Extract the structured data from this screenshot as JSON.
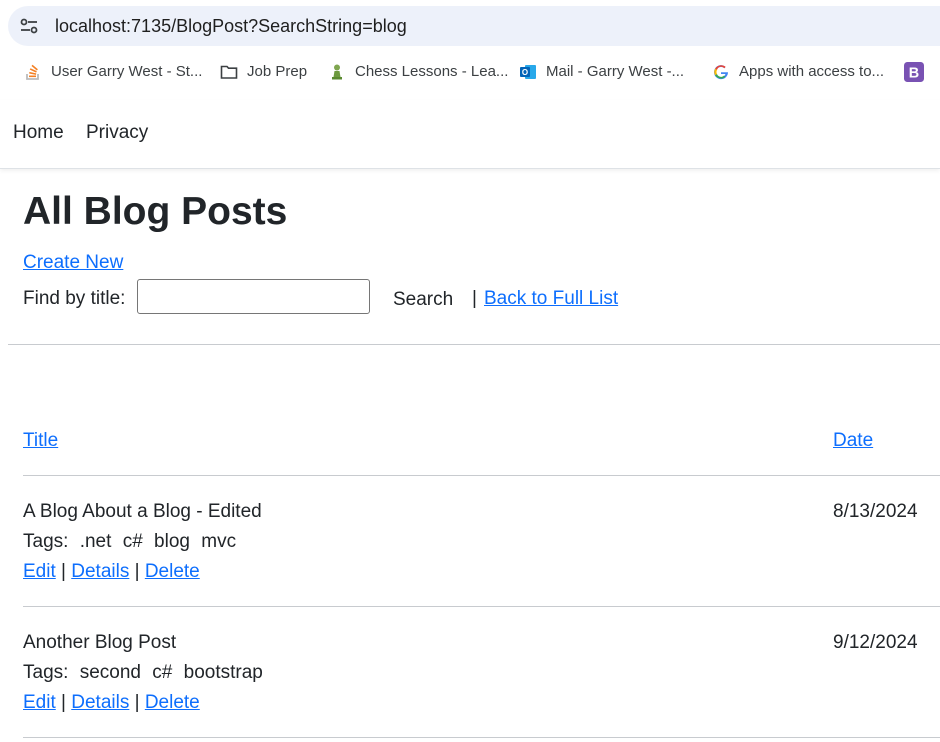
{
  "browser": {
    "url": "localhost:7135/BlogPost?SearchString=blog",
    "bookmarks": [
      {
        "icon": "stackoverflow-icon",
        "label": "User Garry West - St..."
      },
      {
        "icon": "folder-icon",
        "label": "Job Prep"
      },
      {
        "icon": "chess-pawn-icon",
        "label": "Chess Lessons - Lea..."
      },
      {
        "icon": "outlook-icon",
        "label": "Mail - Garry West -..."
      },
      {
        "icon": "google-icon",
        "label": "Apps with access to..."
      },
      {
        "icon": "bootstrap-icon",
        "label": "B"
      }
    ],
    "colors": {
      "address_bar": "#edf1fa",
      "link": "#0d6efd"
    }
  },
  "nav": {
    "home": "Home",
    "privacy": "Privacy"
  },
  "page": {
    "title": "All Blog Posts",
    "create_new": "Create New",
    "find_label": "Find by title:",
    "search_value": "",
    "search_button": "Search",
    "pipe": "|",
    "back_link": "Back to Full List"
  },
  "table": {
    "headers": {
      "title": "Title",
      "date": "Date"
    },
    "rows": [
      {
        "title": "A Blog About a Blog - Edited",
        "tags_label": "Tags:",
        "tags": [
          ".net",
          "c#",
          "blog",
          "mvc"
        ],
        "date": "8/13/2024",
        "actions": {
          "edit": "Edit",
          "details": "Details",
          "delete": "Delete",
          "sep": "|"
        }
      },
      {
        "title": "Another Blog Post",
        "tags_label": "Tags:",
        "tags": [
          "second",
          "c#",
          "bootstrap"
        ],
        "date": "9/12/2024",
        "actions": {
          "edit": "Edit",
          "details": "Details",
          "delete": "Delete",
          "sep": "|"
        }
      }
    ]
  }
}
